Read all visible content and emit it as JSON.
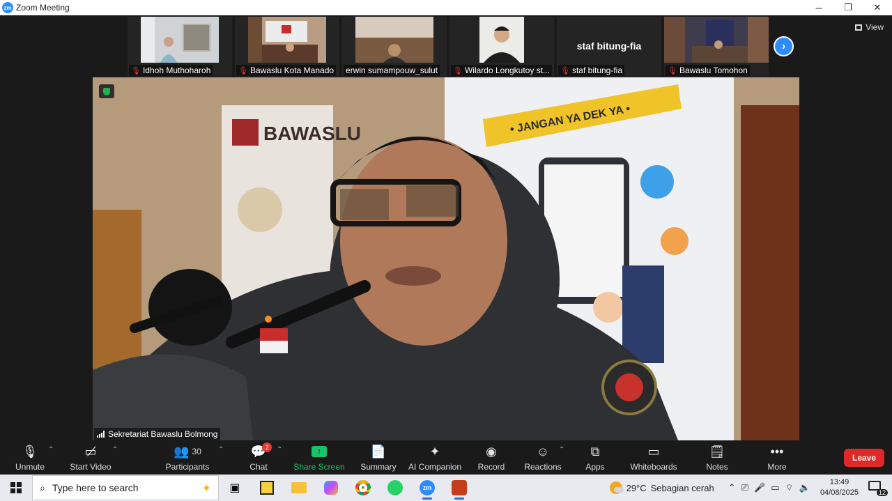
{
  "window": {
    "title": "Zoom Meeting",
    "controls": [
      "─",
      "❐",
      "✕"
    ]
  },
  "gallery": {
    "view_label": "View",
    "tiles": [
      {
        "name": "Idhoh Muthoharoh",
        "muted": true,
        "video": true,
        "bg": "#cfd3d6"
      },
      {
        "name": "Bawaslu Kota Manado",
        "muted": true,
        "video": true,
        "bg": "#b89c83"
      },
      {
        "name": "erwin sumampouw_sulut",
        "muted": false,
        "video": true,
        "bg": "#8a6a4f"
      },
      {
        "name": "Wilardo Longkutoy st...",
        "muted": true,
        "video": true,
        "bg": "#e8e8e6"
      },
      {
        "name": "staf bitung-fia",
        "muted": true,
        "video": false,
        "display_name": "staf bitung-fia"
      },
      {
        "name": "Bawaslu Tomohon",
        "muted": true,
        "video": true,
        "bg": "#3f3d4d"
      }
    ]
  },
  "speaker": {
    "name": "Sekretariat Bawaslu Bolmong",
    "banner_text": "BAWASLU",
    "poster_text": "• JANGAN YA DEK YA •"
  },
  "toolbar": {
    "unmute": "Unmute",
    "start_video": "Start Video",
    "participants": "Participants",
    "participants_count": "30",
    "chat": "Chat",
    "chat_badge": "2",
    "share_screen": "Share Screen",
    "summary": "Summary",
    "ai_companion": "AI Companion",
    "record": "Record",
    "reactions": "Reactions",
    "apps": "Apps",
    "whiteboards": "Whiteboards",
    "notes": "Notes",
    "more": "More",
    "leave": "Leave"
  },
  "taskbar": {
    "search_placeholder": "Type here to search",
    "weather_temp": "29°C",
    "weather_desc": "Sebagian cerah",
    "time": "13:49",
    "date": "04/08/2025",
    "notifications": "12"
  }
}
